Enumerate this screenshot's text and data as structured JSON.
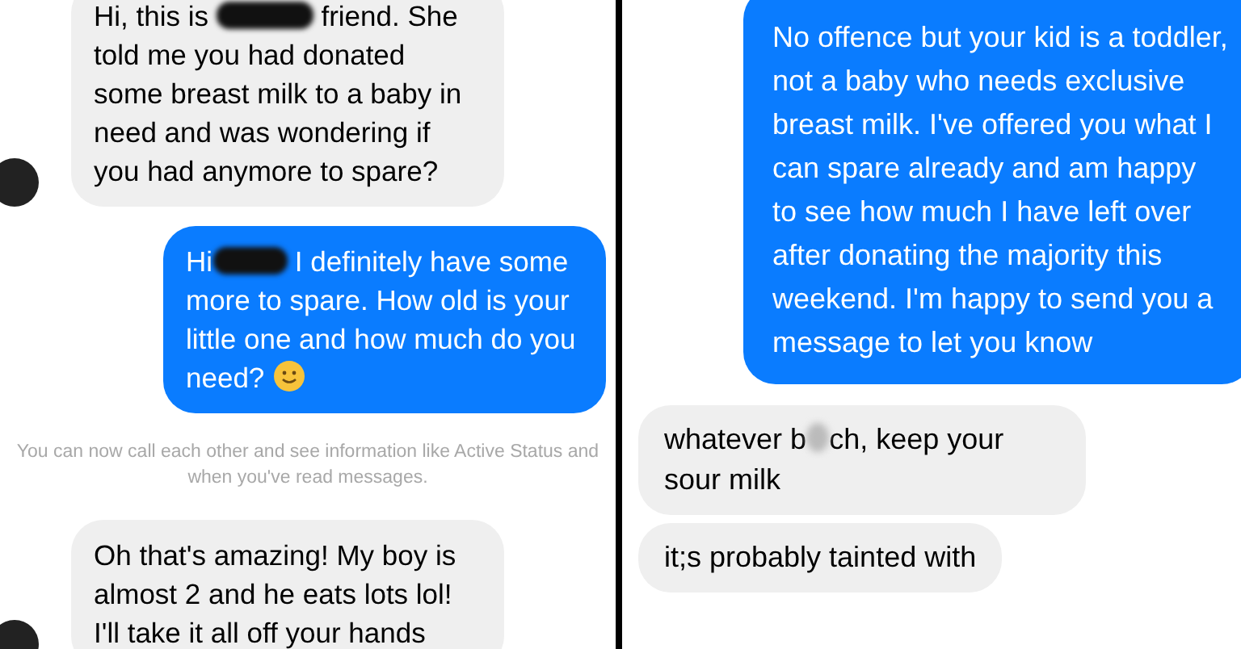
{
  "panels": [
    {
      "messages": [
        {
          "kind": "incoming",
          "avatar": true,
          "segments": [
            {
              "kind": "text",
              "text": "Hi, this is "
            },
            {
              "kind": "redaction"
            },
            {
              "kind": "text",
              "text": " friend. She told me you had donated some breast milk to a baby in need and was wondering if you had anymore to spare?"
            }
          ]
        },
        {
          "kind": "outgoing",
          "avatar": false,
          "segments": [
            {
              "kind": "text",
              "text": "Hi"
            },
            {
              "kind": "redaction"
            },
            {
              "kind": "text",
              "text": " I definitely have some more to spare. How old is your little one and how much do you need? "
            },
            {
              "kind": "emoji"
            }
          ]
        },
        {
          "kind": "notice",
          "avatar": false,
          "segments": [
            {
              "kind": "text",
              "text": "You can now call each other and see information like Active Status and when you've read messages."
            }
          ]
        },
        {
          "kind": "incoming",
          "avatar": true,
          "segments": [
            {
              "kind": "text",
              "text": "Oh that's amazing! My boy is almost 2 and he eats lots lol! I'll take it all off your hands"
            }
          ]
        }
      ]
    },
    {
      "messages": [
        {
          "kind": "outgoing",
          "avatar": false,
          "segments": [
            {
              "kind": "text",
              "text": "No offence but your kid is a toddler, not a baby who needs exclusive breast milk. I've offered you what I can spare already and am happy to see how much I have left over after donating the majority this weekend. I'm happy to send you a message to let you know"
            }
          ]
        },
        {
          "kind": "incoming",
          "avatar": false,
          "segments": [
            {
              "kind": "text",
              "text": "whatever b"
            },
            {
              "kind": "blur"
            },
            {
              "kind": "text",
              "text": "ch, keep your sour milk"
            }
          ]
        },
        {
          "kind": "incoming",
          "avatar": false,
          "segments": [
            {
              "kind": "text",
              "text": "it;s probably tainted with"
            }
          ]
        }
      ]
    }
  ]
}
